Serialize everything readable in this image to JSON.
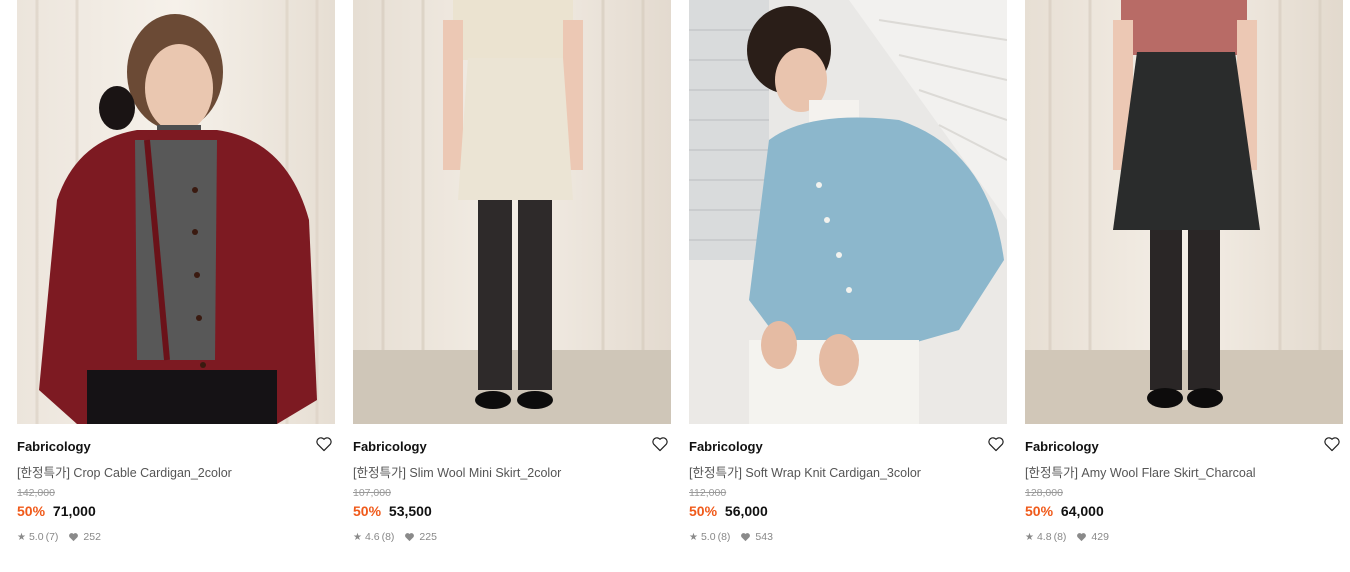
{
  "products": [
    {
      "brand": "Fabricology",
      "name": "[한정특가] Crop Cable Cardigan_2color",
      "original_price": "142,000",
      "discount": "50%",
      "sale_price": "71,000",
      "rating": "5.0",
      "reviews": "(7)",
      "likes": "252"
    },
    {
      "brand": "Fabricology",
      "name": "[한정특가] Slim Wool Mini Skirt_2color",
      "original_price": "107,000",
      "discount": "50%",
      "sale_price": "53,500",
      "rating": "4.6",
      "reviews": "(8)",
      "likes": "225"
    },
    {
      "brand": "Fabricology",
      "name": "[한정특가] Soft Wrap Knit Cardigan_3color",
      "original_price": "112,000",
      "discount": "50%",
      "sale_price": "56,000",
      "rating": "5.0",
      "reviews": "(8)",
      "likes": "543"
    },
    {
      "brand": "Fabricology",
      "name": "[한정특가] Amy Wool Flare Skirt_Charcoal",
      "original_price": "128,000",
      "discount": "50%",
      "sale_price": "64,000",
      "rating": "4.8",
      "reviews": "(8)",
      "likes": "429"
    }
  ],
  "icons": {
    "wishlist": "heart-outline-icon",
    "rating": "star-icon",
    "likes": "heart-filled-icon"
  },
  "colors": {
    "discount": "#f05a1a",
    "text": "#111111",
    "muted": "#888888"
  }
}
